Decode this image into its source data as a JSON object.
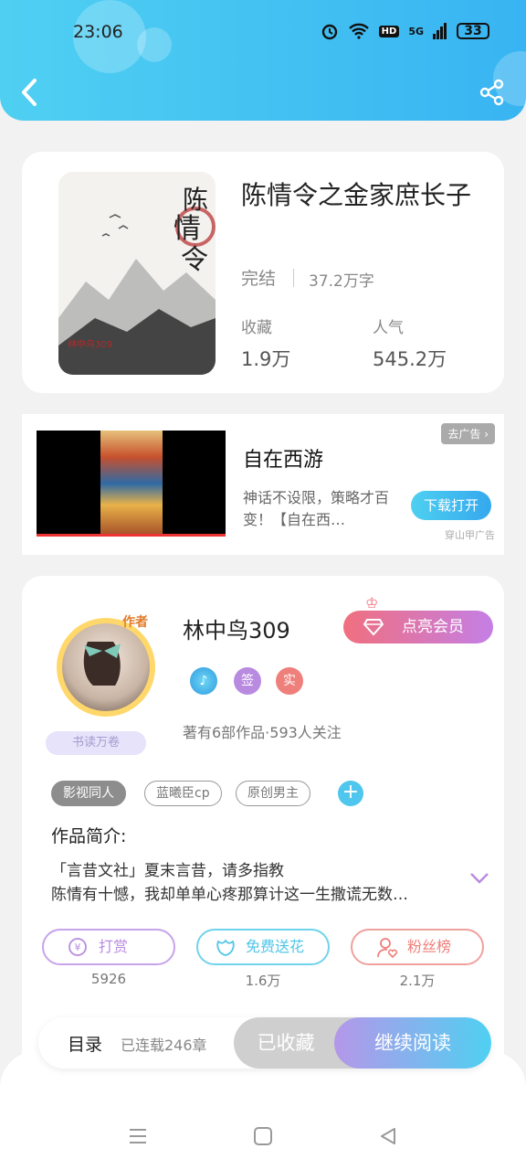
{
  "status_bar": {
    "time": "23:06",
    "network": "5G",
    "hd": "HD",
    "battery": "33"
  },
  "book": {
    "title": "陈情令之金家庶长子",
    "status": "完结",
    "words": "37.2万字",
    "stats": [
      {
        "label": "收藏",
        "value": "1.9万"
      },
      {
        "label": "人气",
        "value": "545.2万"
      }
    ],
    "cover_text": "陈情令"
  },
  "ad": {
    "title": "自在西游",
    "desc": "神话不设限，策略才百变！【自在西…",
    "remove_label": "去广告",
    "button": "下载打开",
    "source": "穿山甲广告"
  },
  "author": {
    "name": "林中鸟309",
    "avatar_tag": "作者",
    "ribbon": "书读万卷",
    "vip_button": "点亮会员",
    "badges": [
      "签",
      "实"
    ],
    "meta": "著有6部作品·593人关注",
    "tags": [
      "影视同人",
      "蓝曦臣cp",
      "原创男主"
    ],
    "intro_label": "作品简介:",
    "intro_lines": [
      "「言昔文社」夏末言昔，请多指教",
      "陈情有十憾，我却单单心疼那算计这一生撒谎无数…"
    ],
    "actions": [
      {
        "label": "打赏",
        "count": "5926",
        "color": "#b98be0"
      },
      {
        "label": "免费送花",
        "count": "1.6万",
        "color": "#4fc6e8"
      },
      {
        "label": "粉丝榜",
        "count": "2.1万",
        "color": "#ee7f7a"
      }
    ]
  },
  "bottom": {
    "toc_label": "目录",
    "toc_count": "已连载246章",
    "collected": "已收藏",
    "read": "继续阅读"
  }
}
